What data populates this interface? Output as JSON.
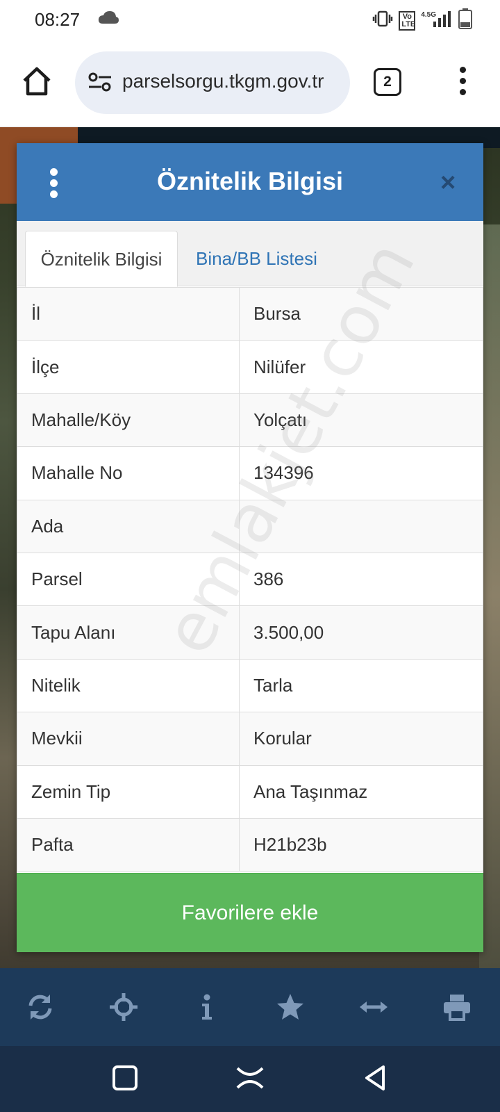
{
  "status_bar": {
    "time": "08:27",
    "icons": [
      "cloud-icon",
      "vibrate-icon",
      "volte-icon",
      "signal-icon",
      "battery-icon"
    ],
    "volte": "Vo LTE",
    "network": "4.5G"
  },
  "browser": {
    "url": "parselsorgu.tkgm.gov.tr",
    "tab_count": "2"
  },
  "dialog": {
    "title": "Öznitelik Bilgisi",
    "close": "×",
    "tabs": [
      {
        "label": "Öznitelik Bilgisi",
        "active": true
      },
      {
        "label": "Bina/BB Listesi",
        "active": false
      }
    ],
    "rows": [
      {
        "label": "İl",
        "value": "Bursa"
      },
      {
        "label": "İlçe",
        "value": "Nilüfer"
      },
      {
        "label": "Mahalle/Köy",
        "value": "Yolçatı"
      },
      {
        "label": "Mahalle No",
        "value": "134396"
      },
      {
        "label": "Ada",
        "value": ""
      },
      {
        "label": "Parsel",
        "value": "386"
      },
      {
        "label": "Tapu Alanı",
        "value": "3.500,00"
      },
      {
        "label": "Nitelik",
        "value": "Tarla"
      },
      {
        "label": "Mevkii",
        "value": "Korular"
      },
      {
        "label": "Zemin Tip",
        "value": "Ana Taşınmaz"
      },
      {
        "label": "Pafta",
        "value": "H21b23b"
      }
    ],
    "favorite_button": "Favorilere ekle",
    "watermark": "emlakjet.com"
  },
  "toolbar": {
    "icons": [
      "refresh-icon",
      "locate-icon",
      "info-icon",
      "star-icon",
      "measure-icon",
      "print-icon"
    ]
  },
  "colors": {
    "header": "#3b79b8",
    "button": "#5cb85c",
    "toolbar": "#1d3a5a",
    "tab_link": "#2f74b5"
  }
}
